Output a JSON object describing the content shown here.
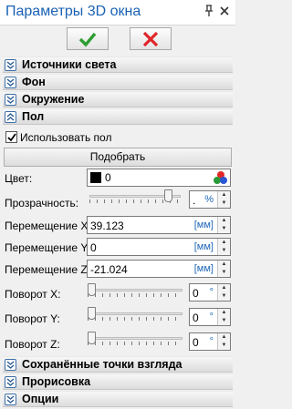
{
  "window": {
    "title": "Параметры 3D окна"
  },
  "sections": {
    "lights": "Источники света",
    "background": "Фон",
    "environment": "Окружение",
    "floor": "Пол",
    "saved_views": "Сохранённые точки взгляда",
    "rendering": "Прорисовка",
    "options": "Опции"
  },
  "floor": {
    "use_floor_label": "Использовать пол",
    "use_floor_checked": true,
    "fit_button": "Подобрать",
    "color_label": "Цвет:",
    "color_value": "0",
    "color_swatch": "#000000",
    "transparency_label": "Прозрачность:",
    "transparency_level": 0.9,
    "transparency_value": ".",
    "transparency_unit": "%",
    "move_x_label": "Перемещение X:",
    "move_x_value": "39.123",
    "move_y_label": "Перемещение Y:",
    "move_y_value": "0",
    "move_z_label": "Перемещение Z:",
    "move_z_value": "-21.024",
    "length_unit": "[мм]",
    "rot_x_label": "Поворот X:",
    "rot_x_value": "0",
    "rot_y_label": "Поворот Y:",
    "rot_y_value": "0",
    "rot_z_label": "Поворот Z:",
    "rot_z_value": "0",
    "angle_unit": "°"
  },
  "colors": {
    "accent_title": "#1a62b5",
    "ok_green": "#2e9e32",
    "cancel_red": "#e0262a",
    "unit_blue": "#1e66b8"
  },
  "icons": {
    "pin": "pin-icon",
    "close": "close-icon",
    "expand": "chevron-double-down-icon",
    "collapse": "chevron-double-up-icon",
    "rgb": "rgb-palette-icon"
  }
}
